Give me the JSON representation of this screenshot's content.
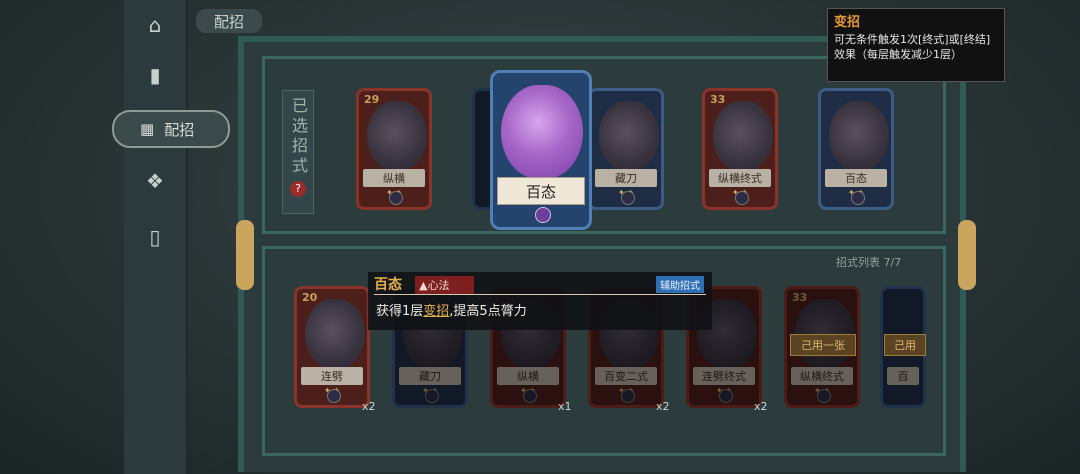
{
  "nav": {
    "header_label": "配招",
    "selected_label": "配招",
    "icons": [
      "house-icon",
      "card-stack-icon",
      "deck-icon",
      "emblem-icon",
      "single-card-icon"
    ]
  },
  "selected_panel": {
    "vertical_label": "已选招式",
    "help": "?"
  },
  "top_cards": [
    {
      "name": "纵横",
      "cost": "29",
      "color": "red"
    },
    {
      "name": "藏刀",
      "cost": "",
      "color": "blue"
    },
    {
      "name": "纵横终式",
      "cost": "33",
      "color": "red"
    },
    {
      "name": "百态",
      "cost": "",
      "color": "blue"
    }
  ],
  "selected_card": {
    "name": "百态"
  },
  "tooltip": {
    "title": "变招",
    "desc": "可无条件触发1次[终式]或[终结]效果（每层触发减少1层）"
  },
  "info": {
    "name": "百态",
    "tag": "心法",
    "aux_tag": "辅助招式",
    "desc_prefix": "获得1层",
    "desc_keyword": "变招",
    "desc_suffix": ",提高5点膂力"
  },
  "list_header": "招式列表 7/7",
  "bottom_cards": [
    {
      "name": "连劈",
      "cost": "20",
      "color": "red",
      "count": "x2",
      "dim": false,
      "used": ""
    },
    {
      "name": "藏刀",
      "cost": "",
      "color": "blue",
      "count": "",
      "dim": true,
      "used": ""
    },
    {
      "name": "纵横",
      "cost": "",
      "color": "red",
      "count": "x1",
      "dim": true,
      "used": ""
    },
    {
      "name": "百变二式",
      "cost": "",
      "color": "red",
      "count": "x2",
      "dim": true,
      "used": ""
    },
    {
      "name": "连劈终式",
      "cost": "",
      "color": "red",
      "count": "x2",
      "dim": true,
      "used": ""
    },
    {
      "name": "纵横终式",
      "cost": "33",
      "color": "red",
      "count": "",
      "dim": true,
      "used": "己用一张"
    },
    {
      "name": "百",
      "cost": "",
      "color": "blue",
      "count": "",
      "dim": true,
      "used": "己用"
    }
  ]
}
